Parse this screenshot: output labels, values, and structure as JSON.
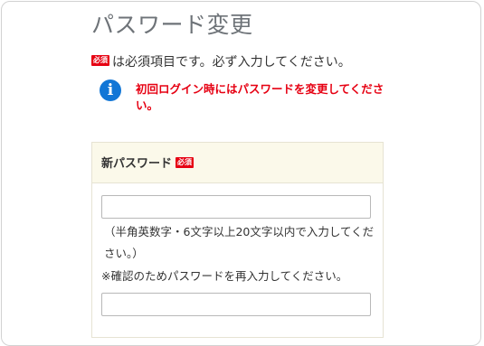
{
  "page": {
    "title": "パスワード変更",
    "required_badge": "必須",
    "required_note": "は必須項目です。必ず入力してください。"
  },
  "notice": {
    "icon": "info-icon",
    "icon_glyph": "i",
    "text": "初回ログイン時にはパスワードを変更してください。",
    "color": "#e60012"
  },
  "form": {
    "new_password": {
      "label": "新パスワード",
      "required_badge": "必須",
      "value": "",
      "hint": "（半角英数字・6文字以上20文字以内で入力してください。）"
    },
    "confirm_password": {
      "label": "※確認のためパスワードを再入力してください。",
      "value": ""
    }
  },
  "colors": {
    "accent_red": "#e60012",
    "info_blue": "#1176d6",
    "panel_header_bg": "#fbf9ea",
    "title_gray": "#6e7378"
  }
}
